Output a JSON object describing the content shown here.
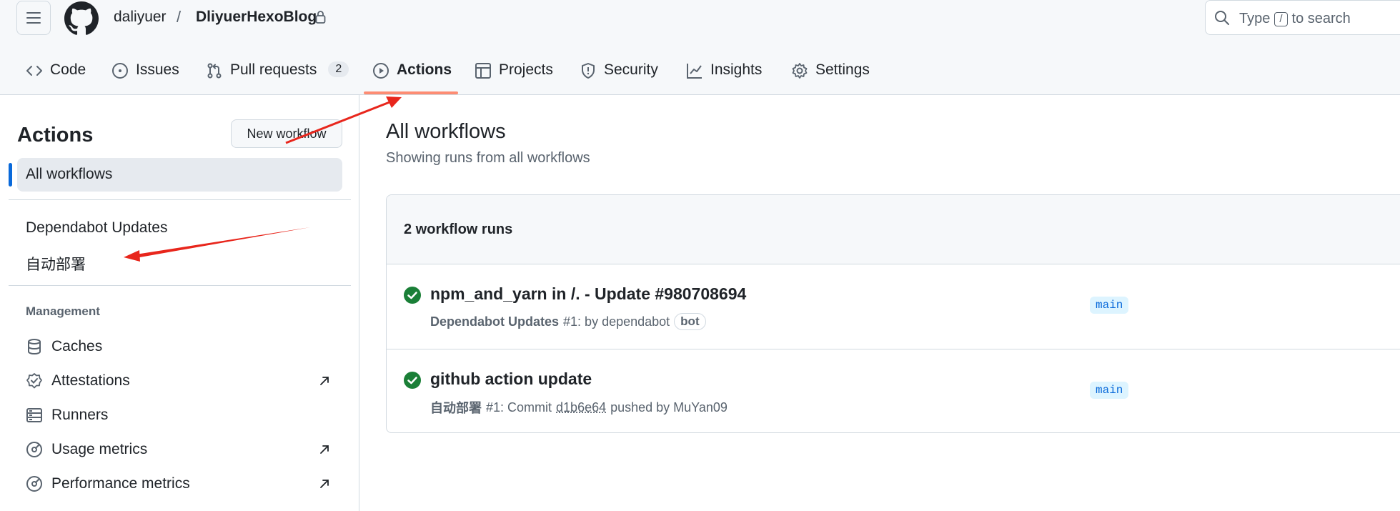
{
  "header": {
    "owner": "daliyuer",
    "separator": "/",
    "repo": "DliyuerHexoBlog",
    "search": {
      "before": "Type",
      "key": "/",
      "after": "to search"
    }
  },
  "tabs": [
    {
      "label": "Code",
      "icon": "code-icon"
    },
    {
      "label": "Issues",
      "icon": "issue-icon"
    },
    {
      "label": "Pull requests",
      "icon": "pull-request-icon",
      "count": "2"
    },
    {
      "label": "Actions",
      "icon": "play-icon",
      "selected": true
    },
    {
      "label": "Projects",
      "icon": "table-icon"
    },
    {
      "label": "Security",
      "icon": "shield-icon"
    },
    {
      "label": "Insights",
      "icon": "graph-icon"
    },
    {
      "label": "Settings",
      "icon": "gear-icon"
    }
  ],
  "sidebar": {
    "title": "Actions",
    "new_workflow": "New workflow",
    "all_workflows": "All workflows",
    "workflows": [
      "Dependabot Updates",
      "自动部署"
    ],
    "management_heading": "Management",
    "management": [
      {
        "label": "Caches",
        "icon": "database-icon"
      },
      {
        "label": "Attestations",
        "icon": "verified-icon",
        "external": true
      },
      {
        "label": "Runners",
        "icon": "server-icon"
      },
      {
        "label": "Usage metrics",
        "icon": "meter-icon",
        "external": true
      },
      {
        "label": "Performance metrics",
        "icon": "meter-icon",
        "external": true
      }
    ]
  },
  "main": {
    "title": "All workflows",
    "subtitle": "Showing runs from all workflows",
    "runs_count": "2 workflow runs",
    "runs": [
      {
        "title": "npm_and_yarn in /. - Update #980708694",
        "workflow": "Dependabot Updates",
        "meta": "#1: by dependabot",
        "label": "bot",
        "branch": "main",
        "status": "success"
      },
      {
        "title": "github action update",
        "workflow": "自动部署",
        "meta_prefix": "#1: Commit",
        "sha": "d1b6e64",
        "meta_suffix": "pushed by MuYan09",
        "branch": "main",
        "status": "success"
      }
    ]
  },
  "colors": {
    "accent": "#0969da",
    "tab_underline": "#fd8c73",
    "success": "#1a7f37",
    "annotation_arrow": "#e8261c"
  }
}
